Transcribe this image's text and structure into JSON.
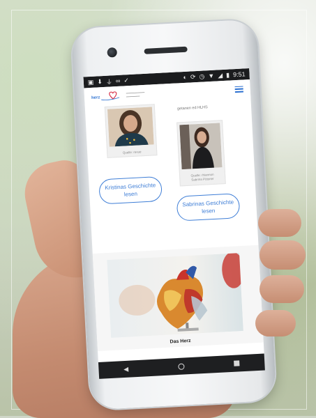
{
  "status_bar": {
    "time": "9:51",
    "left_icons": [
      "image-icon",
      "download-icon",
      "usb-icon",
      "voicemail-icon",
      "signal-check-icon"
    ],
    "right_icons": [
      "dnd-icon",
      "sync-icon",
      "alarm-icon",
      "wifi-icon",
      "cell-signal-icon",
      "battery-icon"
    ]
  },
  "header": {
    "logo_text": "herzkind",
    "menu_icon": "hamburger-icon"
  },
  "stories": {
    "reading_label": "getanen ed HLHS",
    "portrait_1_caption": "Quelle: revue",
    "portrait_2_caption_line1": "Quelle: rhiannon",
    "portrait_2_caption_line2": "Sabrina Pötsner",
    "button_kristina": "Kristinas Geschichte lesen",
    "button_sabrina": "Sabrinas Geschichte lesen"
  },
  "feature": {
    "title": "Das Herz"
  },
  "nav": {
    "back_icon": "back-triangle-icon",
    "home_icon": "home-circle-icon",
    "recent_icon": "recent-square-icon"
  },
  "colors": {
    "accent": "#3d7dd6",
    "status_bar_bg": "#1b1c1e",
    "nav_bar_bg": "#1e1f21"
  }
}
